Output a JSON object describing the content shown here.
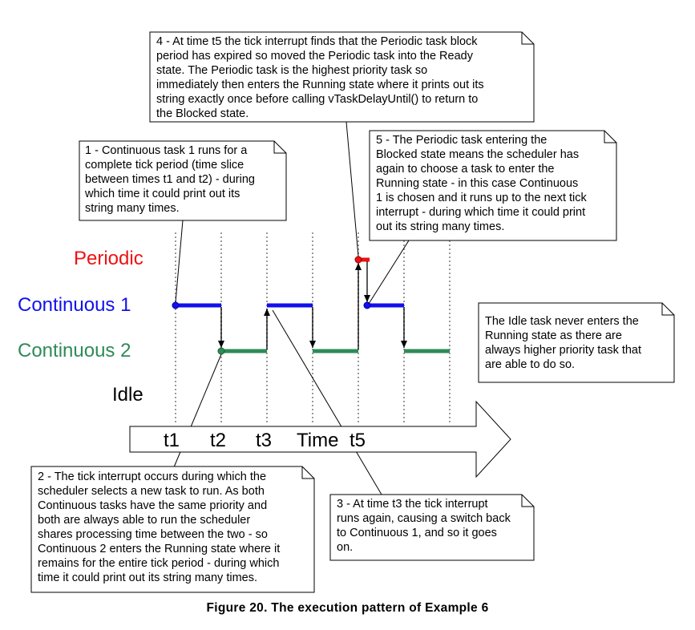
{
  "lanes": {
    "periodic": {
      "label": "Periodic",
      "color": "#ee1111"
    },
    "continuous1": {
      "label": "Continuous 1",
      "color": "#1111ee"
    },
    "continuous2": {
      "label": "Continuous 2",
      "color": "#2e8b57"
    },
    "idle": {
      "label": "Idle",
      "color": "#000000"
    }
  },
  "time_axis": {
    "ticks": [
      "t1",
      "t2",
      "t3",
      "Time",
      "t5"
    ]
  },
  "callouts": {
    "c1": [
      "1 - Continuous task 1 runs for a",
      "complete tick period (time slice",
      "between times t1 and t2) - during",
      "which time it could print out its",
      "string many times."
    ],
    "c2": [
      "2 - The tick interrupt occurs during which the",
      "scheduler selects a new task to run.  As both",
      "Continuous tasks have the same priority and",
      "both are always able to run the scheduler",
      "shares processing time between the two - so",
      "Continuous 2 enters the Running state where it",
      "remains for the entire tick period - during which",
      "time it could print out its string many times."
    ],
    "c3": [
      "3 - At time t3 the tick interrupt",
      "runs again, causing a switch back",
      "to Continuous 1, and so it goes",
      "on."
    ],
    "c4": [
      "4 - At time t5 the tick interrupt finds that the Periodic task block",
      "period has expired so moved the Periodic task into the Ready",
      "state.  The Periodic task is the highest priority task so",
      "immediately then enters the Running state where it prints out its",
      "string exactly once before calling vTaskDelayUntil() to return to",
      "the Blocked state."
    ],
    "c5": [
      "5 - The Periodic task entering the",
      "Blocked state means the scheduler has",
      "again to choose a task to enter the",
      "Running state - in this case Continuous",
      "1 is chosen and it runs up to the next tick",
      "interrupt - during which time it could print",
      "out its string many times."
    ],
    "idle_note": [
      "The Idle task never enters the",
      "Running state as there are",
      "always higher priority task that",
      "are able to do so."
    ]
  },
  "caption": "Figure 20.  The execution pattern of Example 6"
}
